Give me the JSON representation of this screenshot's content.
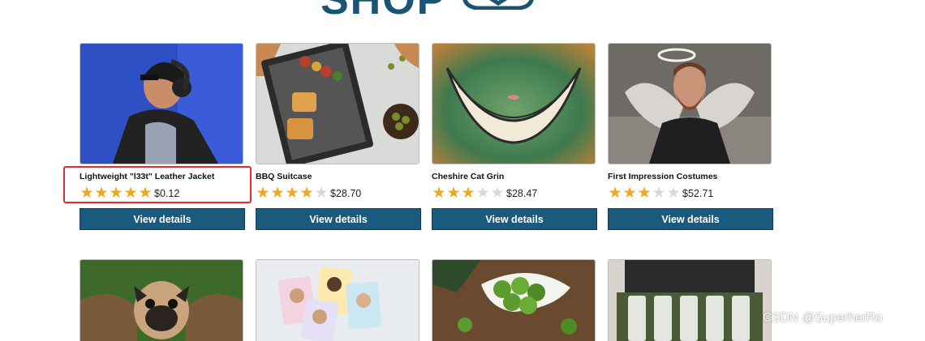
{
  "header": {
    "logo_text": "SHOP"
  },
  "products": [
    {
      "title": "Lightweight \"l33t\" Leather Jacket",
      "stars": 5,
      "price": "$0.12",
      "button": "View details",
      "image_icon": "person-with-headphones-image"
    },
    {
      "title": "BBQ Suitcase",
      "stars": 4,
      "price": "$28.70",
      "button": "View details",
      "image_icon": "bbq-grill-image"
    },
    {
      "title": "Cheshire Cat Grin",
      "stars": 3,
      "price": "$28.47",
      "button": "View details",
      "image_icon": "cheshire-grin-image"
    },
    {
      "title": "First Impression Costumes",
      "stars": 3,
      "price": "$52.71",
      "button": "View details",
      "image_icon": "angel-man-image"
    }
  ],
  "row2_images": [
    "pug-with-wings-image",
    "photo-cards-image",
    "brussels-sprouts-image",
    "beer-belt-image"
  ],
  "watermark": "CSDN @SuperherRo",
  "colors": {
    "brand": "#1a5472",
    "button": "#1a5a7e",
    "star_on": "#f0a71c",
    "star_off": "#d9d9d9",
    "highlight": "#e52b2b"
  }
}
